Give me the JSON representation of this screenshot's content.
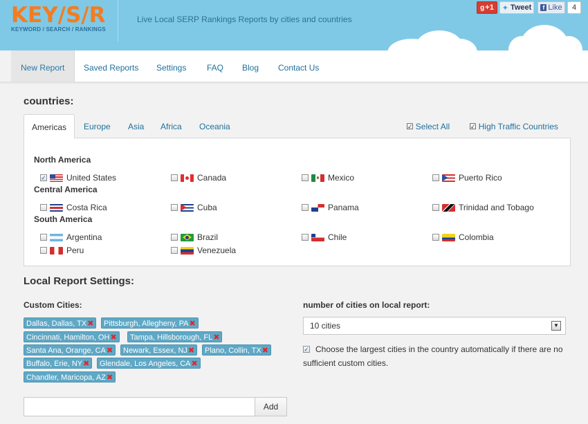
{
  "header": {
    "logo": {
      "text": "KEY/S/R",
      "subtitle": "KEYWORD / SEARCH / RANKINGS"
    },
    "tagline": "Live Local SERP Rankings Reports by cities and countries",
    "social": {
      "gplus_label": "+1",
      "tweet_label": "Tweet",
      "fb_label": "Like",
      "fb_count": "4"
    }
  },
  "nav": {
    "items": [
      "New Report",
      "Saved Reports",
      "Settings",
      "FAQ",
      "Blog",
      "Contact Us"
    ],
    "active": "New Report"
  },
  "countries_section": {
    "title": "countries:",
    "tabs": [
      "Americas",
      "Europe",
      "Asia",
      "Africa",
      "Oceania"
    ],
    "active_tab": "Americas",
    "select_all": "Select All",
    "high_traffic": "High Traffic Countries",
    "regions": [
      {
        "name": "North America",
        "countries": [
          {
            "name": "United States",
            "checked": true
          },
          {
            "name": "Canada",
            "checked": false
          },
          {
            "name": "Mexico",
            "checked": false
          },
          {
            "name": "Puerto Rico",
            "checked": false
          }
        ]
      },
      {
        "name": "Central America",
        "countries": [
          {
            "name": "Costa Rica",
            "checked": false
          },
          {
            "name": "Cuba",
            "checked": false
          },
          {
            "name": "Panama",
            "checked": false
          },
          {
            "name": "Trinidad and Tobago",
            "checked": false
          }
        ]
      },
      {
        "name": "South America",
        "countries": [
          {
            "name": "Argentina",
            "checked": false
          },
          {
            "name": "Brazil",
            "checked": false
          },
          {
            "name": "Chile",
            "checked": false
          },
          {
            "name": "Colombia",
            "checked": false
          },
          {
            "name": "Peru",
            "checked": false
          },
          {
            "name": "Venezuela",
            "checked": false
          }
        ]
      }
    ]
  },
  "local_settings": {
    "title": "Local Report Settings:",
    "custom_cities_label": "Custom Cities:",
    "cities": [
      "Dallas, Dallas, TX",
      "Pittsburgh, Allegheny, PA",
      "Cincinnati, Hamilton, OH",
      "Tampa, Hillsborough, FL",
      "Santa Ana, Orange, CA",
      "Newark, Essex, NJ",
      "Plano, Collin, TX",
      "Buffalo, Erie, NY",
      "Glendale, Los Angeles, CA",
      "Chandler, Maricopa, AZ"
    ],
    "remove_icon": "close-icon",
    "num_cities_label": "number of cities on local report:",
    "num_cities_value": "10 cities",
    "auto_check_label": "Choose the largest cities in the country automatically if there are no sufficient custom cities.",
    "auto_check_checked": true,
    "add_button": "Add",
    "add_input_value": ""
  },
  "colors": {
    "brand_orange": "#f47c20",
    "header_blue": "#7fc9e6",
    "link_blue": "#1f6f9c",
    "tag_blue": "#5fa8c6",
    "remove_red": "#e0262b"
  }
}
